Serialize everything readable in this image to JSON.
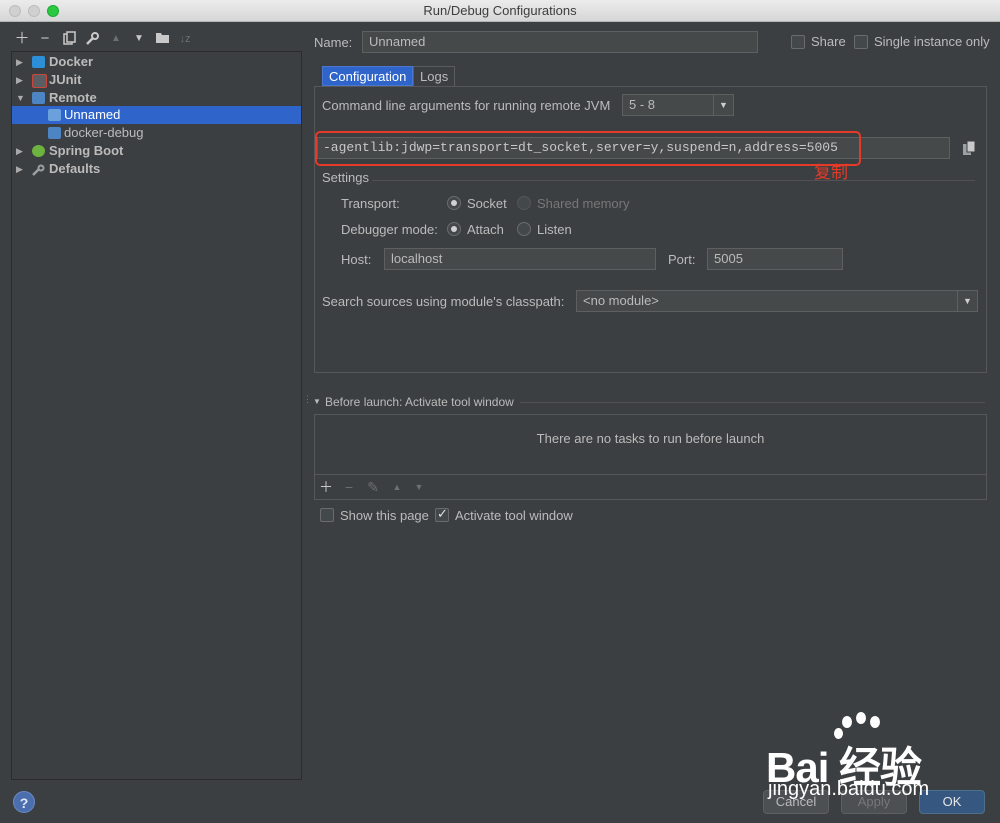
{
  "window": {
    "title": "Run/Debug Configurations"
  },
  "left_toolbar": [
    "plus-icon",
    "minus-icon",
    "copy-icon",
    "wrench-icon",
    "arrow-up-icon",
    "arrow-down-icon",
    "folder-icon",
    "sort-icon"
  ],
  "tree": {
    "items": [
      {
        "label": "Docker",
        "expanded": false,
        "bold": true,
        "icon": "docker-icon"
      },
      {
        "label": "JUnit",
        "expanded": false,
        "bold": true,
        "icon": "junit-icon"
      },
      {
        "label": "Remote",
        "expanded": true,
        "bold": true,
        "icon": "remote-icon"
      },
      {
        "label": "Unnamed",
        "selected": true,
        "icon": "remote-config-icon"
      },
      {
        "label": "docker-debug",
        "icon": "remote-config-icon"
      },
      {
        "label": "Spring Boot",
        "expanded": false,
        "bold": true,
        "icon": "spring-boot-icon"
      },
      {
        "label": "Defaults",
        "expanded": false,
        "bold": true,
        "icon": "wrench-icon"
      }
    ]
  },
  "header": {
    "name_label": "Name:",
    "name_value": "Unnamed",
    "share_label": "Share",
    "share_checked": false,
    "single_instance_label": "Single instance only",
    "single_instance_checked": false
  },
  "tabs": [
    {
      "label": "Configuration",
      "active": true
    },
    {
      "label": "Logs",
      "active": false
    }
  ],
  "config": {
    "cmdline_label": "Command line arguments for running remote JVM",
    "jvm_version": "5 - 8",
    "cmdline_value": "-agentlib:jdwp=transport=dt_socket,server=y,suspend=n,address=5005",
    "annotation": "复制",
    "settings_label": "Settings",
    "transport_label": "Transport:",
    "transport_options": [
      {
        "label": "Socket",
        "selected": true
      },
      {
        "label": "Shared memory",
        "selected": false,
        "disabled": true
      }
    ],
    "debugger_mode_label": "Debugger mode:",
    "debugger_mode_options": [
      {
        "label": "Attach",
        "selected": true
      },
      {
        "label": "Listen",
        "selected": false
      }
    ],
    "host_label": "Host:",
    "host_value": "localhost",
    "port_label": "Port:",
    "port_value": "5005",
    "module_label": "Search sources using module's classpath:",
    "module_value": "<no module>"
  },
  "before_launch": {
    "title": "Before launch: Activate tool window",
    "empty_text": "There are no tasks to run before launch",
    "tools": [
      "plus-icon",
      "minus-icon",
      "edit-icon",
      "arrow-up-icon",
      "arrow-down-icon"
    ]
  },
  "footer": {
    "show_page_label": "Show this page",
    "show_page_checked": false,
    "activate_tool_label": "Activate tool window",
    "activate_tool_checked": true,
    "cancel_label": "Cancel",
    "apply_label": "Apply",
    "ok_label": "OK"
  },
  "watermark": {
    "brand": "Bai  经验",
    "url": "jingyan.baidu.com"
  },
  "colors": {
    "selection": "#2f65ca",
    "annotation": "#e53a27",
    "ok_button": "#365880"
  }
}
